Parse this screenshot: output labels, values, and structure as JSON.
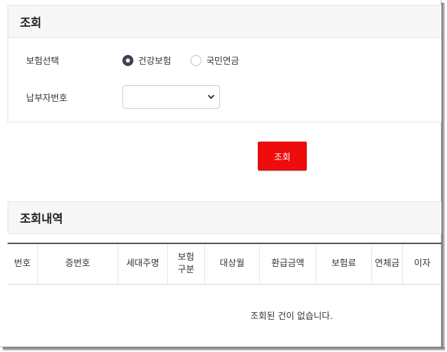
{
  "search_panel": {
    "title": "조회",
    "insurance_label": "보험선택",
    "radio_options": [
      {
        "label": "건강보험",
        "selected": true
      },
      {
        "label": "국민연금",
        "selected": false
      }
    ],
    "payer_label": "납부자번호",
    "payer_select_value": ""
  },
  "search_button": {
    "label": "조회"
  },
  "results": {
    "title": "조회내역",
    "columns": [
      "번호",
      "증번호",
      "세대주명",
      "보험\n구분",
      "대상월",
      "환급금액",
      "보험료",
      "연체금",
      "이자"
    ],
    "empty_message": "조회된 건이 없습니다."
  },
  "colors": {
    "accent_button": "#ee0c0c",
    "radio_selected": "#3d4150",
    "table_top_border": "#4a4e5a"
  }
}
